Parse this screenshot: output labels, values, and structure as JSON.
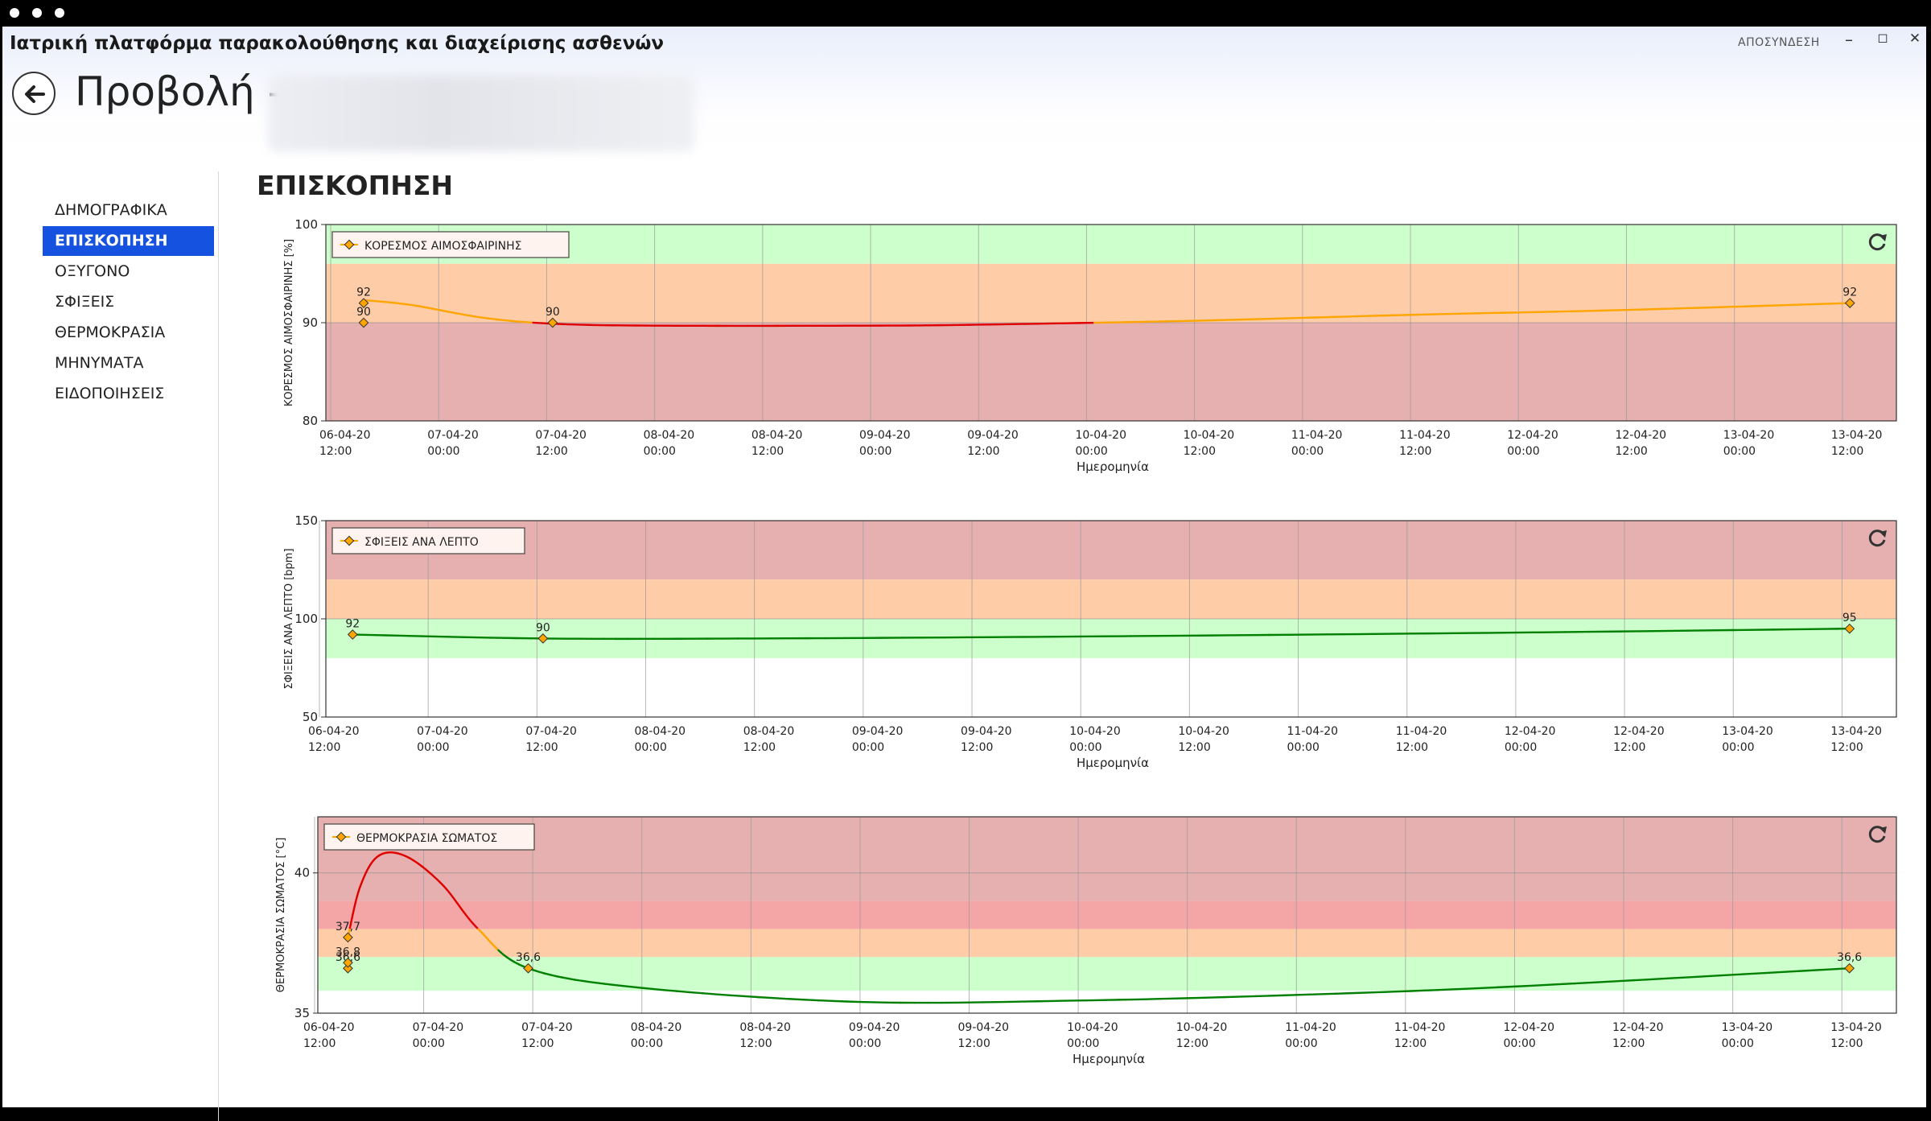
{
  "window": {
    "app_title": "Ιατρική πλατφόρμα παρακολούθησης και διαχείρισης ασθενών",
    "logout_label": "ΑΠΟΣΥΝΔΕΣΗ",
    "minimize_glyph": "–",
    "maximize_glyph": "◻",
    "close_glyph": "✕"
  },
  "header": {
    "page_title": "Προβολή -"
  },
  "sidebar": {
    "items": [
      {
        "label": "ΔΗΜΟΓΡΑΦΙΚΑ",
        "active": false
      },
      {
        "label": "ΕΠΙΣΚΟΠΗΣΗ",
        "active": true
      },
      {
        "label": "ΟΞΥΓΟΝΟ",
        "active": false
      },
      {
        "label": "ΣΦΙΞΕΙΣ",
        "active": false
      },
      {
        "label": "ΘΕΡΜΟΚΡΑΣΙΑ",
        "active": false
      },
      {
        "label": "ΜΗΝΥΜΑΤΑ",
        "active": false
      },
      {
        "label": "ΕΙΔΟΠΟΙΗΣΕΙΣ",
        "active": false
      }
    ]
  },
  "main": {
    "section_title": "ΕΠΙΣΚΟΠΗΣΗ"
  },
  "colors": {
    "accent": "#1652e0",
    "zone_green": "#ccffcc",
    "zone_orange": "#ffcca8",
    "zone_red": "#e6b0b0",
    "zone_bright_red": "#f4a6a6",
    "line_green": "#008000",
    "line_orange": "#ffa500",
    "line_red": "#e00000",
    "marker_fill": "#ffa500"
  },
  "chart_data": [
    {
      "type": "line",
      "legend": "ΚΟΡΕΣΜΟΣ ΑΙΜΟΣΦΑΙΡΙΝΗΣ",
      "ylabel": "ΚΟΡΕΣΜΟΣ ΑΙΜΟΣΦΑΙΡΙΝΗΣ [%]",
      "xlabel": "Ημερομηνία",
      "ylim": [
        80,
        100
      ],
      "yticks": [
        80,
        90,
        100
      ],
      "xlim": [
        "2020-04-06 12:00",
        "2020-04-13 18:00"
      ],
      "xticks": [
        {
          "d": "06-04-20",
          "t": "12:00"
        },
        {
          "d": "07-04-20",
          "t": "00:00"
        },
        {
          "d": "07-04-20",
          "t": "12:00"
        },
        {
          "d": "08-04-20",
          "t": "00:00"
        },
        {
          "d": "08-04-20",
          "t": "12:00"
        },
        {
          "d": "09-04-20",
          "t": "00:00"
        },
        {
          "d": "09-04-20",
          "t": "12:00"
        },
        {
          "d": "10-04-20",
          "t": "00:00"
        },
        {
          "d": "10-04-20",
          "t": "12:00"
        },
        {
          "d": "11-04-20",
          "t": "00:00"
        },
        {
          "d": "11-04-20",
          "t": "12:00"
        },
        {
          "d": "12-04-20",
          "t": "00:00"
        },
        {
          "d": "12-04-20",
          "t": "12:00"
        },
        {
          "d": "13-04-20",
          "t": "00:00"
        },
        {
          "d": "13-04-20",
          "t": "12:00"
        }
      ],
      "zones": [
        {
          "from": 96,
          "to": 100,
          "color": "#ccffcc"
        },
        {
          "from": 90,
          "to": 96,
          "color": "#ffcca8"
        },
        {
          "from": 80,
          "to": 90,
          "color": "#e6b0b0"
        }
      ],
      "points": [
        {
          "x": "2020-04-06 15:40",
          "y": 90,
          "label": "90"
        },
        {
          "x": "2020-04-06 15:40",
          "y": 92,
          "label": "92"
        },
        {
          "x": "2020-04-07 12:40",
          "y": 90,
          "label": "90"
        },
        {
          "x": "2020-04-13 12:50",
          "y": 92,
          "label": "92"
        }
      ],
      "curve": [
        {
          "x": "2020-04-06 15:40",
          "y": 92.3
        },
        {
          "x": "2020-04-06 21:00",
          "y": 91.8
        },
        {
          "x": "2020-04-07 05:00",
          "y": 90.5
        },
        {
          "x": "2020-04-07 12:40",
          "y": 89.9
        },
        {
          "x": "2020-04-08 00:00",
          "y": 89.7
        },
        {
          "x": "2020-04-09 00:00",
          "y": 89.7
        },
        {
          "x": "2020-04-09 12:00",
          "y": 89.8
        },
        {
          "x": "2020-04-10 12:00",
          "y": 90.2
        },
        {
          "x": "2020-04-11 12:00",
          "y": 90.8
        },
        {
          "x": "2020-04-12 12:00",
          "y": 91.3
        },
        {
          "x": "2020-04-13 12:50",
          "y": 92
        }
      ],
      "thresholds": [
        {
          "below": 90,
          "color": "#e00000"
        },
        {
          "below": 96,
          "color": "#ffa500"
        },
        {
          "below": 1000,
          "color": "#008000"
        }
      ]
    },
    {
      "type": "line",
      "legend": "ΣΦΙΞΕΙΣ ΑΝΑ ΛΕΠΤΟ",
      "ylabel": "ΣΦΙΞΕΙΣ ΑΝΑ ΛΕΠΤΟ [bpm]",
      "xlabel": "Ημερομηνία",
      "ylim": [
        50,
        150
      ],
      "yticks": [
        50,
        100,
        150
      ],
      "xlim": [
        "2020-04-06 12:00",
        "2020-04-13 18:00"
      ],
      "xticks": [
        {
          "d": "06-04-20",
          "t": "12:00"
        },
        {
          "d": "07-04-20",
          "t": "00:00"
        },
        {
          "d": "07-04-20",
          "t": "12:00"
        },
        {
          "d": "08-04-20",
          "t": "00:00"
        },
        {
          "d": "08-04-20",
          "t": "12:00"
        },
        {
          "d": "09-04-20",
          "t": "00:00"
        },
        {
          "d": "09-04-20",
          "t": "12:00"
        },
        {
          "d": "10-04-20",
          "t": "00:00"
        },
        {
          "d": "10-04-20",
          "t": "12:00"
        },
        {
          "d": "11-04-20",
          "t": "00:00"
        },
        {
          "d": "11-04-20",
          "t": "12:00"
        },
        {
          "d": "12-04-20",
          "t": "00:00"
        },
        {
          "d": "12-04-20",
          "t": "12:00"
        },
        {
          "d": "13-04-20",
          "t": "00:00"
        },
        {
          "d": "13-04-20",
          "t": "12:00"
        }
      ],
      "zones": [
        {
          "from": 120,
          "to": 150,
          "color": "#e6b0b0"
        },
        {
          "from": 100,
          "to": 120,
          "color": "#ffcca8"
        },
        {
          "from": 80,
          "to": 100,
          "color": "#ccffcc"
        }
      ],
      "points": [
        {
          "x": "2020-04-06 15:40",
          "y": 92,
          "label": "92"
        },
        {
          "x": "2020-04-07 12:40",
          "y": 90,
          "label": "90"
        },
        {
          "x": "2020-04-13 12:50",
          "y": 95,
          "label": "95"
        }
      ],
      "curve": [
        {
          "x": "2020-04-06 15:40",
          "y": 92
        },
        {
          "x": "2020-04-07 12:40",
          "y": 90
        },
        {
          "x": "2020-04-08 12:00",
          "y": 90
        },
        {
          "x": "2020-04-10 00:00",
          "y": 91
        },
        {
          "x": "2020-04-12 00:00",
          "y": 93
        },
        {
          "x": "2020-04-13 12:50",
          "y": 95
        }
      ],
      "thresholds": [
        {
          "below": 100,
          "color": "#008000"
        },
        {
          "below": 120,
          "color": "#ffa500"
        },
        {
          "below": 1000,
          "color": "#e00000"
        }
      ]
    },
    {
      "type": "line",
      "legend": "ΘΕΡΜΟΚΡΑΣΙΑ ΣΩΜΑΤΟΣ",
      "ylabel": "ΘΕΡΜΟΚΡΑΣΙΑ ΣΩΜΑΤΟΣ [°C]",
      "xlabel": "Ημερομηνία",
      "ylim": [
        35,
        42
      ],
      "yticks": [
        35,
        40
      ],
      "xlim": [
        "2020-04-06 12:00",
        "2020-04-13 18:00"
      ],
      "xticks": [
        {
          "d": "06-04-20",
          "t": "12:00"
        },
        {
          "d": "07-04-20",
          "t": "00:00"
        },
        {
          "d": "07-04-20",
          "t": "12:00"
        },
        {
          "d": "08-04-20",
          "t": "00:00"
        },
        {
          "d": "08-04-20",
          "t": "12:00"
        },
        {
          "d": "09-04-20",
          "t": "00:00"
        },
        {
          "d": "09-04-20",
          "t": "12:00"
        },
        {
          "d": "10-04-20",
          "t": "00:00"
        },
        {
          "d": "10-04-20",
          "t": "12:00"
        },
        {
          "d": "11-04-20",
          "t": "00:00"
        },
        {
          "d": "11-04-20",
          "t": "12:00"
        },
        {
          "d": "12-04-20",
          "t": "00:00"
        },
        {
          "d": "12-04-20",
          "t": "12:00"
        },
        {
          "d": "13-04-20",
          "t": "00:00"
        },
        {
          "d": "13-04-20",
          "t": "12:00"
        }
      ],
      "zones": [
        {
          "from": 39,
          "to": 42,
          "color": "#e6b0b0"
        },
        {
          "from": 38,
          "to": 39,
          "color": "#f4a6a6"
        },
        {
          "from": 37,
          "to": 38,
          "color": "#ffcca8"
        },
        {
          "from": 35.8,
          "to": 37,
          "color": "#ccffcc"
        }
      ],
      "points": [
        {
          "x": "2020-04-06 15:40",
          "y": 36.6,
          "label": "36,6"
        },
        {
          "x": "2020-04-06 15:40",
          "y": 36.8,
          "label": "36,8"
        },
        {
          "x": "2020-04-06 15:40",
          "y": 37.7,
          "label": "37,7"
        },
        {
          "x": "2020-04-07 11:30",
          "y": 36.6,
          "label": "36,6"
        },
        {
          "x": "2020-04-13 12:50",
          "y": 36.6,
          "label": "36,6"
        }
      ],
      "curve": [
        {
          "x": "2020-04-06 15:40",
          "y": 37.7
        },
        {
          "x": "2020-04-06 17:00",
          "y": 39.5
        },
        {
          "x": "2020-04-06 19:00",
          "y": 40.6
        },
        {
          "x": "2020-04-06 22:00",
          "y": 40.6
        },
        {
          "x": "2020-04-07 02:00",
          "y": 39.6
        },
        {
          "x": "2020-04-07 06:00",
          "y": 38.0
        },
        {
          "x": "2020-04-07 11:30",
          "y": 36.6
        },
        {
          "x": "2020-04-08 00:00",
          "y": 35.9
        },
        {
          "x": "2020-04-09 00:00",
          "y": 35.4
        },
        {
          "x": "2020-04-10 00:00",
          "y": 35.45
        },
        {
          "x": "2020-04-11 00:00",
          "y": 35.65
        },
        {
          "x": "2020-04-12 00:00",
          "y": 35.95
        },
        {
          "x": "2020-04-13 12:50",
          "y": 36.6
        }
      ],
      "thresholds": [
        {
          "below": 37.2,
          "color": "#008000"
        },
        {
          "below": 38,
          "color": "#ffa500"
        },
        {
          "below": 1000,
          "color": "#e00000"
        }
      ]
    }
  ]
}
